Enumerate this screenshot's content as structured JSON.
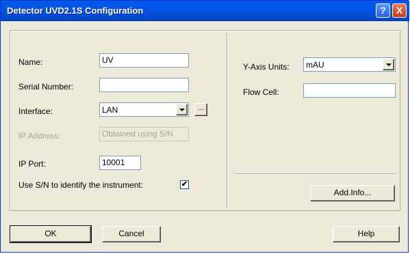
{
  "window": {
    "title": "Detector UVD2.1S Configuration",
    "help_glyph": "?",
    "close_glyph": "X"
  },
  "left": {
    "name_label": "Name:",
    "name_value": "UV",
    "serial_label": "Serial Number:",
    "serial_value": "",
    "interface_label": "Interface:",
    "interface_value": "LAN",
    "browse_label": "...",
    "ip_address_label": "IP Address:",
    "ip_address_value": "Obtained using S/N",
    "ip_port_label": "IP Port:",
    "ip_port_value": "10001",
    "use_sn_label": "Use S/N to identify the instrument:",
    "use_sn_checked": true,
    "check_glyph": "✔"
  },
  "right": {
    "y_axis_label": "Y-Axis Units:",
    "y_axis_value": "mAU",
    "flow_cell_label": "Flow Cell:",
    "flow_cell_value": "",
    "add_info_label": "Add.Info..."
  },
  "footer": {
    "ok_label": "OK",
    "cancel_label": "Cancel",
    "help_label": "Help"
  }
}
